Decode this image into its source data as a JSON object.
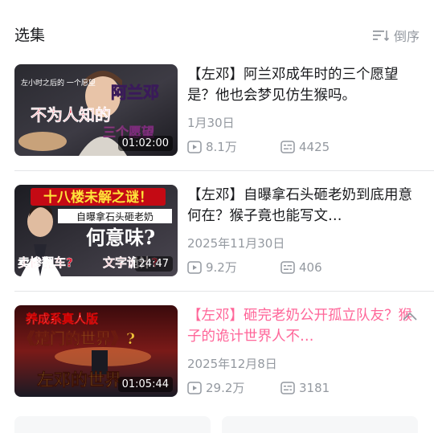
{
  "header": {
    "title": "选集",
    "sort_label": "倒序"
  },
  "colors": {
    "accent": "#ff6699",
    "text_primary": "#18191c",
    "text_secondary": "#9499a0",
    "divider": "#e3e5e7"
  },
  "episodes": [
    {
      "title": "【左邓】阿兰邓成年时的三个愿望是？他也会梦见仿生猴吗。",
      "date": "1月30日",
      "views": "8.1万",
      "comments": "4425",
      "duration": "01:02:00",
      "active": false,
      "thumb_text": [
        "阿兰邓",
        "不为人知的",
        "三个愿望",
        "左小时之后的 一个愿望"
      ]
    },
    {
      "title": "【左邓】自曝拿石头砸老奶到底用意何在？猴子竟也能写文…",
      "date": "2025年11月30日",
      "views": "9.2万",
      "comments": "406",
      "duration": "24:47",
      "active": false,
      "thumb_text": [
        "十八楼未解之谜！",
        "自曝拿石头砸老奶",
        "何意味?",
        "卖惨翻车?",
        "文字诡计?"
      ]
    },
    {
      "title": "【左邓】砸完老奶公开孤立队友？猴子的诡计世界人不…",
      "date": "2025年12月8日",
      "views": "29.2万",
      "comments": "3181",
      "duration": "01:05:44",
      "active": true,
      "thumb_text": [
        "养成系真人版",
        "《楚门的世界》?",
        "左邓的世界"
      ]
    }
  ],
  "icons": {
    "sort": "sort-descending-icon",
    "views": "play-icon",
    "comments": "danmaku-icon",
    "collapse": "chevron-up-icon"
  }
}
